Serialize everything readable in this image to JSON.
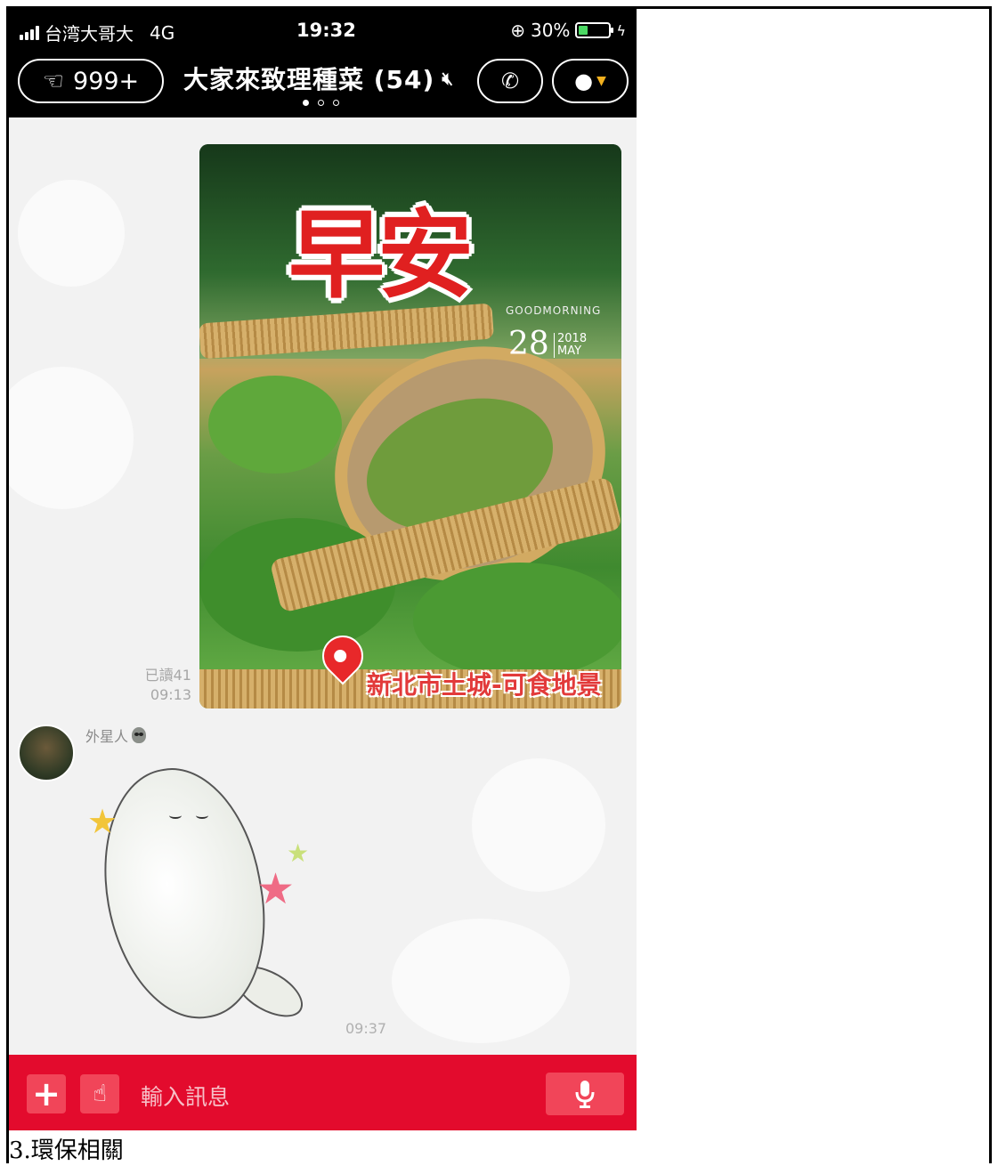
{
  "status_bar": {
    "carrier": "台湾大哥大",
    "network": "4G",
    "time": "19:32",
    "battery": "30%",
    "battery_level": 0.3
  },
  "header": {
    "back_count": "999+",
    "title": "大家來致理種菜 (54)",
    "muted": true
  },
  "messages": [
    {
      "type": "image",
      "read_status": "已讀41",
      "time": "09:13",
      "image": {
        "greeting": "早安",
        "subtitle": "GOODMORNING",
        "day": "28",
        "year": "2018",
        "month": "MAY",
        "location": "新北市土城-可食地景"
      }
    },
    {
      "type": "sticker",
      "sender": "外星人",
      "time": "09:37"
    }
  ],
  "input": {
    "placeholder": "輸入訊息"
  },
  "caption": "3.環保相關",
  "colors": {
    "input_bar": "#e30b2d",
    "header_bg": "#000000",
    "chat_bg": "#f2f2f2"
  }
}
